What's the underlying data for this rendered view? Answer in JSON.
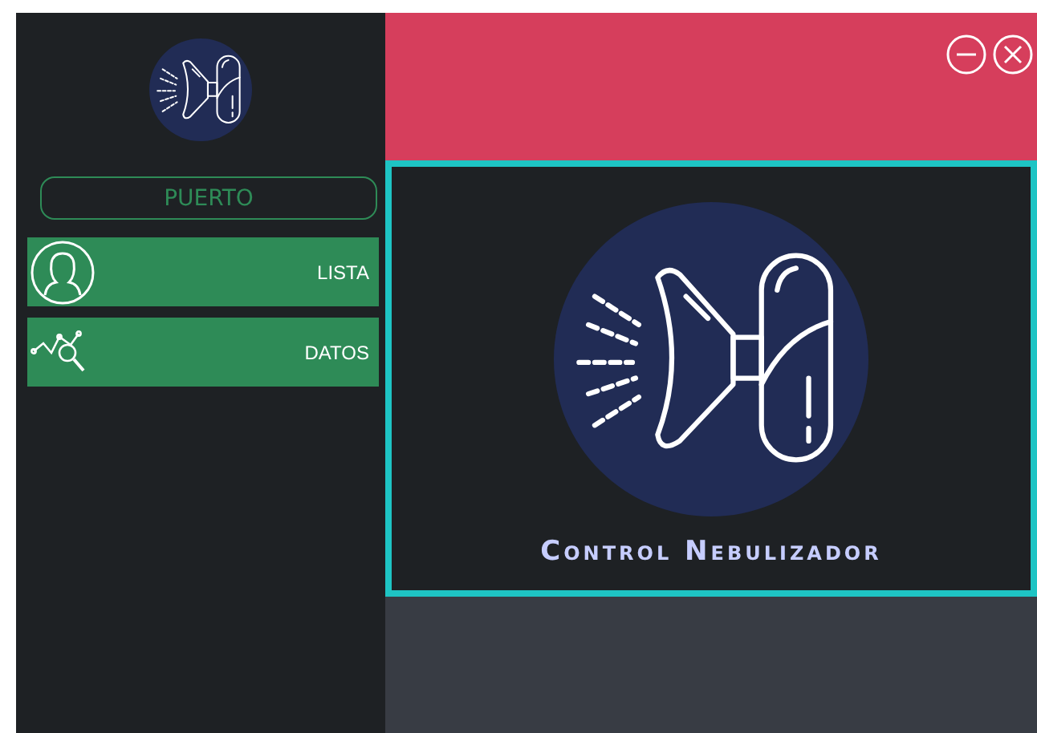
{
  "sidebar": {
    "port_button": "PUERTO",
    "items": [
      {
        "label": "LISTA",
        "kind": "person"
      },
      {
        "label": "DATOS",
        "kind": "chart"
      }
    ]
  },
  "main": {
    "title": "Control Nebulizador"
  }
}
